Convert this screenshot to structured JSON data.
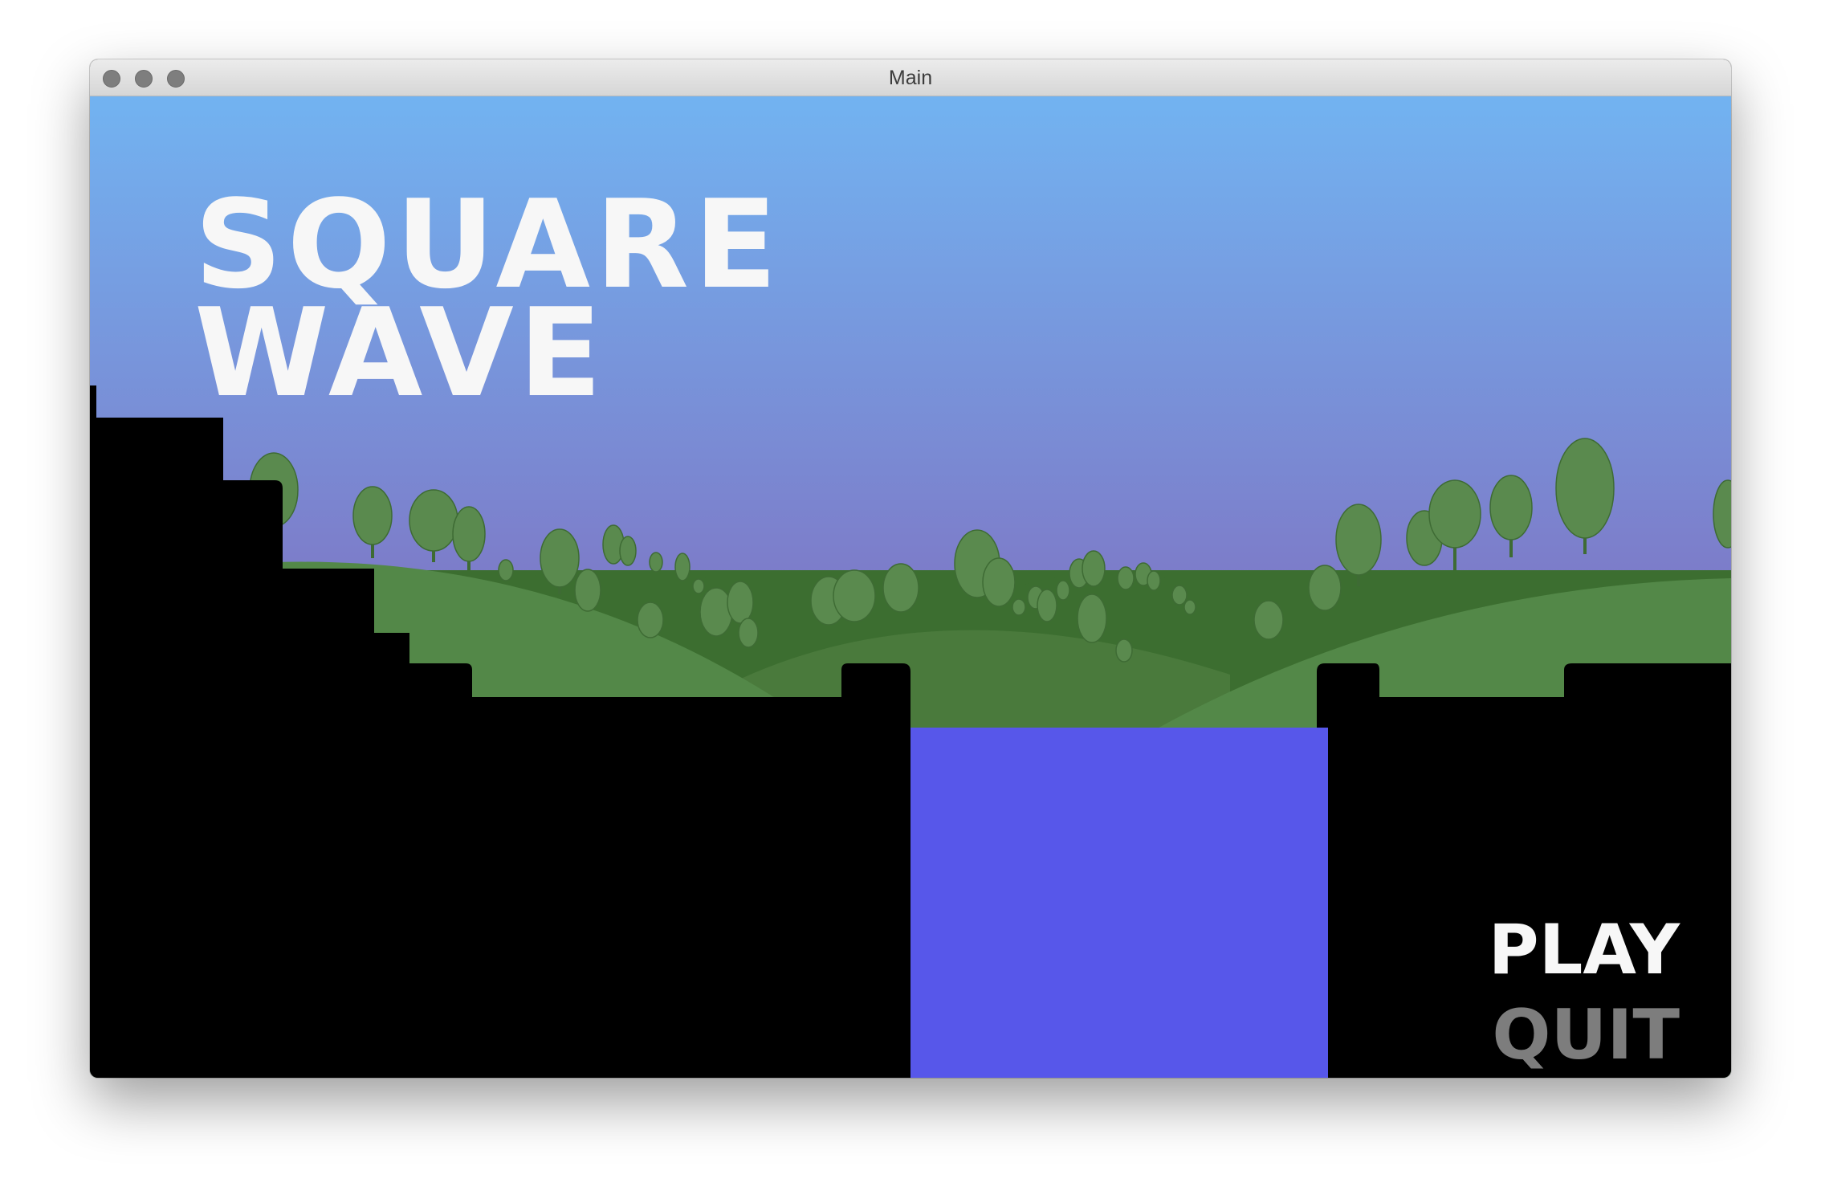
{
  "window": {
    "title": "Main"
  },
  "game": {
    "logo": {
      "line1": "SQUARE",
      "line2": "WAVE"
    },
    "menu": {
      "play": "PLAY",
      "quit": "QUIT"
    },
    "colors": {
      "sky_top": "#72b3f1",
      "sky_bottom": "#7e75c4",
      "hill_far": "#3c6e30",
      "hill_mid": "#4a7a3c",
      "hill_near": "#538848",
      "tree": "#5a8a4e",
      "water": "#5757ea",
      "ground": "#000000",
      "menu_active": "#f7f7f7",
      "menu_inactive": "#7d7d7d"
    }
  }
}
